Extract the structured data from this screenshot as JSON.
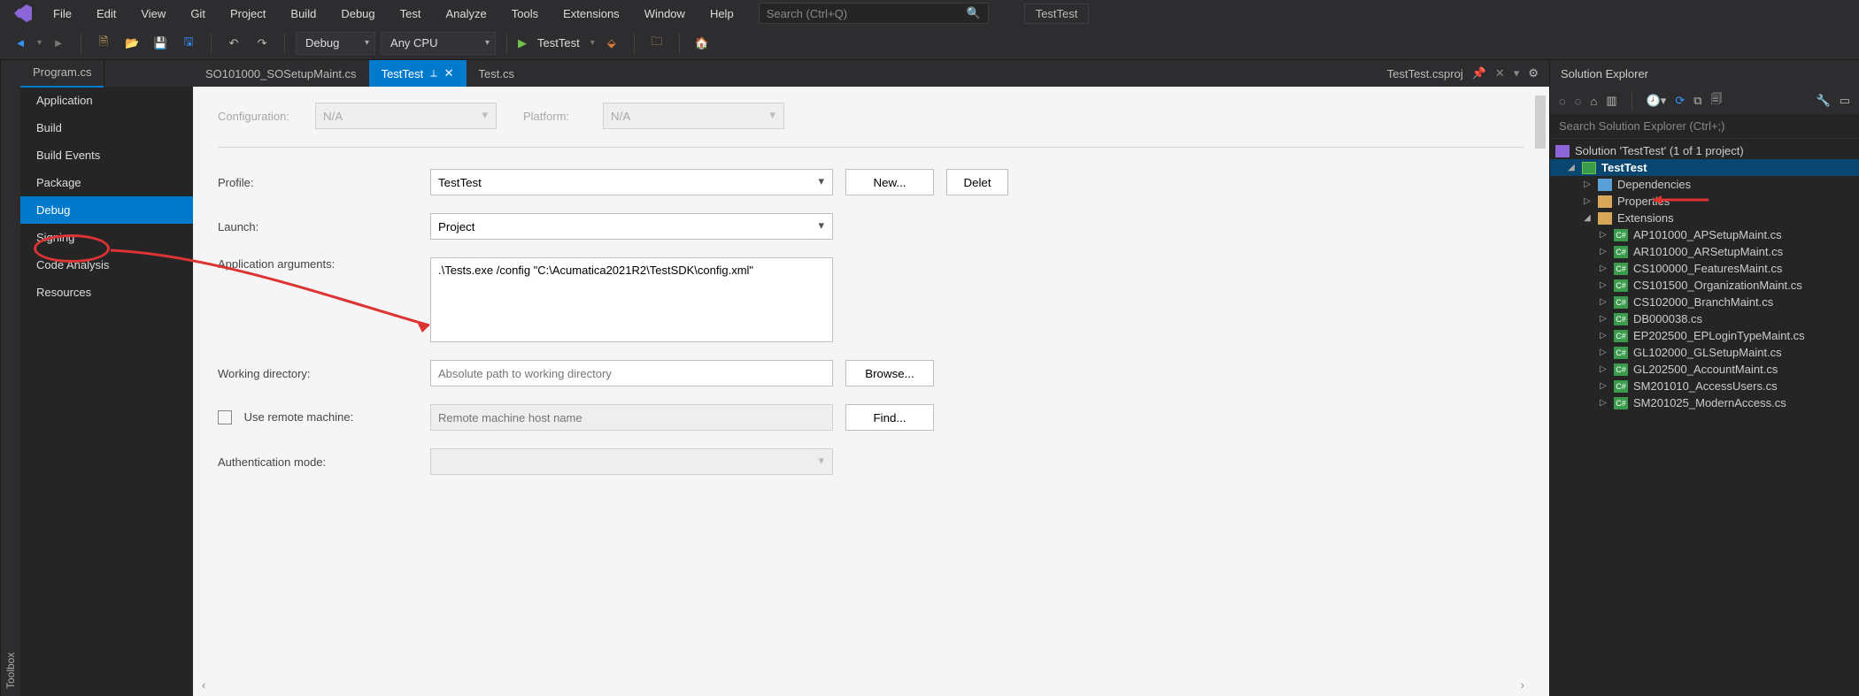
{
  "menu": {
    "items": [
      "File",
      "Edit",
      "View",
      "Git",
      "Project",
      "Build",
      "Debug",
      "Test",
      "Analyze",
      "Tools",
      "Extensions",
      "Window",
      "Help"
    ]
  },
  "searchPlaceholder": "Search (Ctrl+Q)",
  "windowTitle": "TestTest",
  "toolbar": {
    "config": "Debug",
    "platform": "Any CPU",
    "startTarget": "TestTest"
  },
  "toolboxLabel": "Toolbox",
  "docTabs": [
    "Program.cs",
    "SO101000_SOSetupMaint.cs"
  ],
  "sideNav": [
    "Application",
    "Build",
    "Build Events",
    "Package",
    "Debug",
    "Signing",
    "Code Analysis",
    "Resources"
  ],
  "sideNavActive": "Debug",
  "editorTabs": {
    "extra": "Test.cs",
    "active": "TestTest",
    "rightLabel": "TestTest.csproj"
  },
  "properties": {
    "configLabel": "Configuration:",
    "configValue": "N/A",
    "platformLabel": "Platform:",
    "platformValue": "N/A",
    "profileLabel": "Profile:",
    "profileValue": "TestTest",
    "newBtn": "New...",
    "deleteBtn": "Delet",
    "launchLabel": "Launch:",
    "launchValue": "Project",
    "appArgsLabel": "Application arguments:",
    "appArgsValue": ".\\Tests.exe /config \"C:\\Acumatica2021R2\\TestSDK\\config.xml\"",
    "workDirLabel": "Working directory:",
    "workDirPlaceholder": "Absolute path to working directory",
    "browseBtn": "Browse...",
    "remoteLabel": "Use remote machine:",
    "remotePlaceholder": "Remote machine host name",
    "findBtn": "Find...",
    "authLabel": "Authentication mode:"
  },
  "solutionExplorer": {
    "title": "Solution Explorer",
    "searchPlaceholder": "Search Solution Explorer (Ctrl+;)",
    "root": "Solution 'TestTest' (1 of 1 project)",
    "project": "TestTest",
    "nodes": {
      "dependencies": "Dependencies",
      "properties": "Properties",
      "extensions": "Extensions"
    },
    "files": [
      "AP101000_APSetupMaint.cs",
      "AR101000_ARSetupMaint.cs",
      "CS100000_FeaturesMaint.cs",
      "CS101500_OrganizationMaint.cs",
      "CS102000_BranchMaint.cs",
      "DB000038.cs",
      "EP202500_EPLoginTypeMaint.cs",
      "GL102000_GLSetupMaint.cs",
      "GL202500_AccountMaint.cs",
      "SM201010_AccessUsers.cs",
      "SM201025_ModernAccess.cs"
    ]
  }
}
